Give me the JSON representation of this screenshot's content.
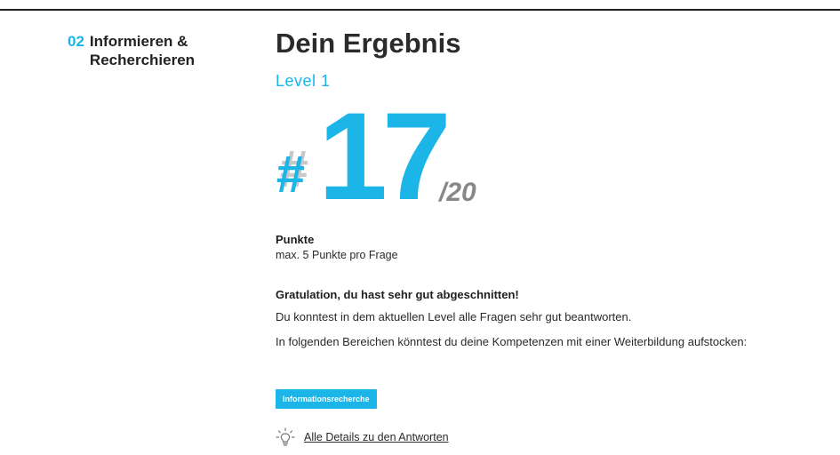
{
  "section": {
    "number": "02",
    "name": "Informieren & Recherchieren"
  },
  "result": {
    "title": "Dein Ergebnis",
    "level": "Level 1",
    "score_prefix": "#",
    "score_value": "17",
    "score_max": "/20",
    "points_label": "Punkte",
    "points_sub": "max. 5 Punkte pro Frage",
    "congrats": "Gratulation, du hast sehr gut abgeschnitten!",
    "text1": "Du konntest in dem aktuellen Level alle Fragen sehr gut beantworten.",
    "text2": "In folgenden Bereichen könntest du deine Kompetenzen mit einer Weiterbildung aufstocken:",
    "tag": "Informationsrecherche",
    "details_link": "Alle Details zu den Antworten",
    "details_icon": "lightbulb-icon"
  },
  "colors": {
    "accent": "#1bb5e8",
    "text": "#222222",
    "muted": "#888888"
  }
}
